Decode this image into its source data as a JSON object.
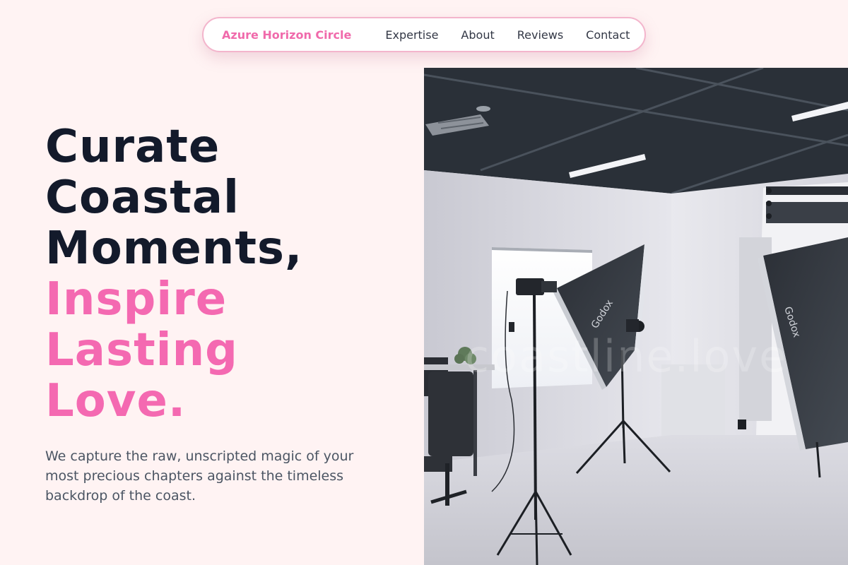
{
  "nav": {
    "brand": "Azure Horizon Circle",
    "links": [
      "Expertise",
      "About",
      "Reviews",
      "Contact"
    ]
  },
  "hero": {
    "headline_dark": [
      "Curate",
      "Coastal",
      "Moments,"
    ],
    "headline_pink": [
      "Inspire",
      "Lasting",
      "Love."
    ],
    "subtitle": "We capture the raw, unscripted magic of your most precious chapters against the timeless backdrop of the coast."
  },
  "photo": {
    "watermark": "coastline.love",
    "softbox_brand": "Godox"
  },
  "colors": {
    "background": "#fff3f3",
    "accent_pink": "#f469b1",
    "brand_pink": "#f06aab",
    "heading_dark": "#131a2b",
    "body_text": "#4b5563"
  }
}
